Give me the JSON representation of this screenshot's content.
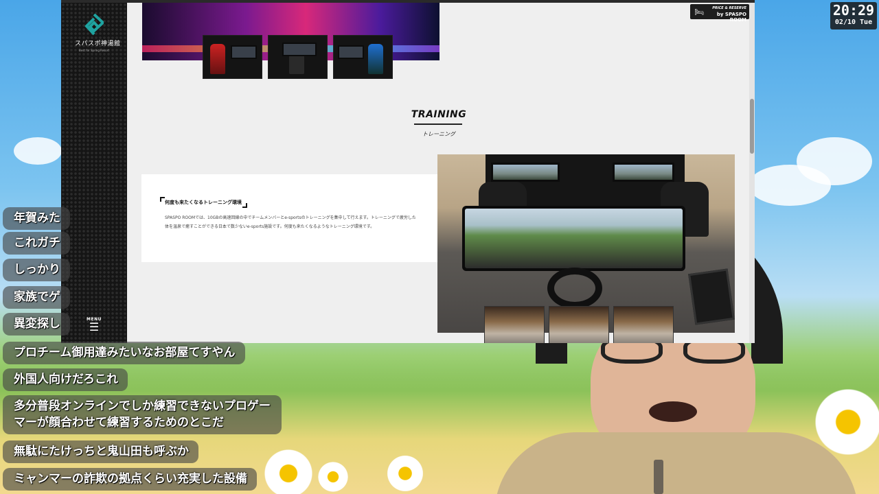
{
  "clock": {
    "time": "20:29",
    "date": "02/10 Tue"
  },
  "site": {
    "logo_name": "スパスポ神湯館",
    "logo_sub": "Best for Spring Resort",
    "menu_label": "MENU",
    "menu_icon": "☰",
    "price_badge": {
      "line1": "PRICE & RESERVE",
      "line2": "by SPASPO ROOM",
      "icon": "bed-icon"
    },
    "section": {
      "title": "TRAINING",
      "subtitle": "トレーニング"
    },
    "card": {
      "heading": "何度も来たくなるトレーニング環境",
      "body": "SPASPO ROOMでは、10GBの高速回線の中でチームメンバーとe-sportsのトレーニングを集中して行えます。トレーニングで疲労した体を温泉で癒すことができる日本で数少ないe-sports施設です。何度も来たくなるようなトレーニング環境です。"
    },
    "accent": "#1fa3a0"
  },
  "chat": [
    {
      "text": "年賀みた"
    },
    {
      "text": "これガチ"
    },
    {
      "text": "しっかり"
    },
    {
      "text": "家族でゲ"
    },
    {
      "text": "異変探し"
    },
    {
      "text": "プロチーム御用達みたいなお部屋てすやん"
    },
    {
      "text": "外国人向けだろこれ"
    },
    {
      "text": "多分普段オンラインでしか練習できないプロゲーマーが顔合わせて練習するためのとこだ"
    },
    {
      "text": "無駄にたけっちと鬼山田も呼ぶか"
    },
    {
      "text": "ミャンマーの詐欺の拠点くらい充実した設備"
    }
  ]
}
